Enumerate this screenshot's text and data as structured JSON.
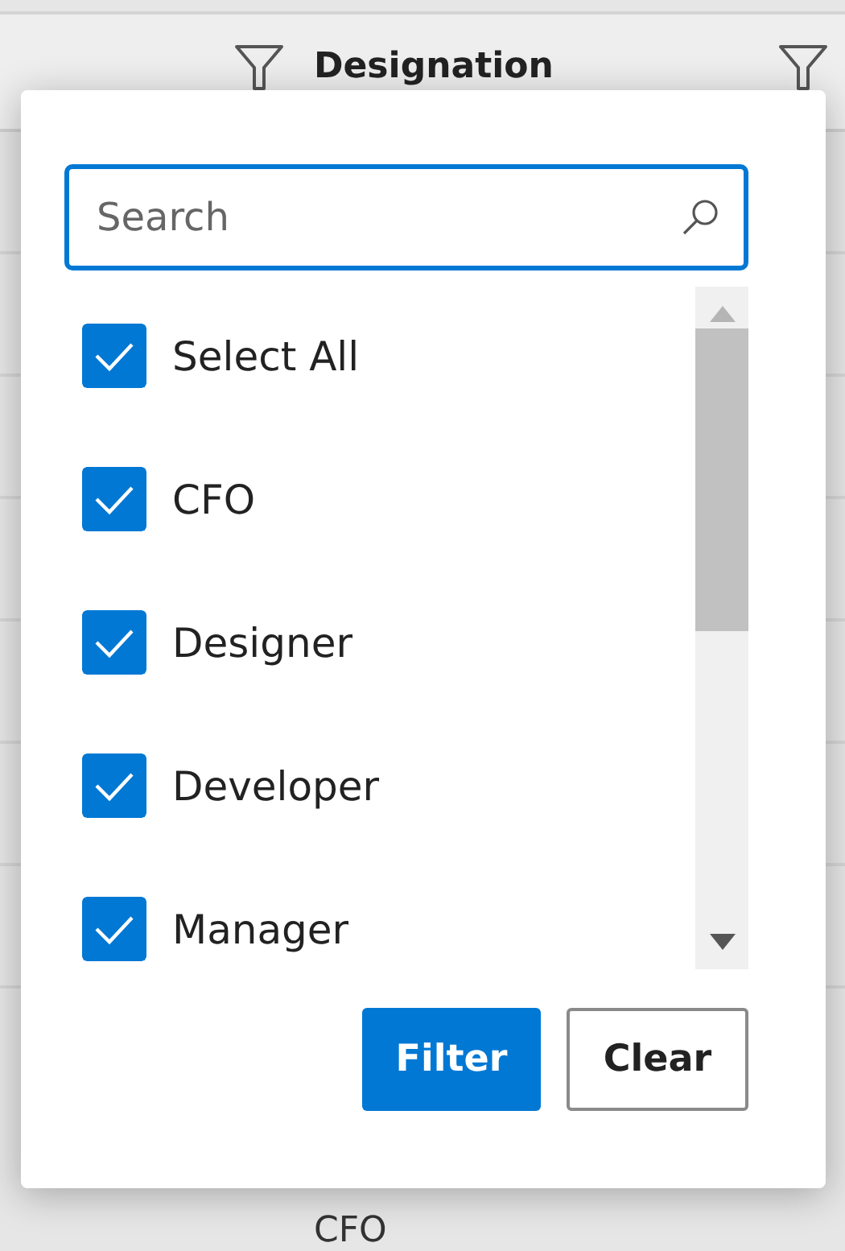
{
  "table": {
    "columns": [
      {
        "label": "Designation"
      }
    ],
    "rows": [
      {
        "designation": "CFO"
      }
    ]
  },
  "filter_popup": {
    "search": {
      "placeholder": "Search"
    },
    "items": [
      {
        "label": "Select All",
        "checked": true
      },
      {
        "label": "CFO",
        "checked": true
      },
      {
        "label": "Designer",
        "checked": true
      },
      {
        "label": "Developer",
        "checked": true
      },
      {
        "label": "Manager",
        "checked": true
      }
    ],
    "buttons": [
      {
        "label": "Filter",
        "kind": "primary"
      },
      {
        "label": "Clear",
        "kind": "secondary"
      }
    ]
  }
}
